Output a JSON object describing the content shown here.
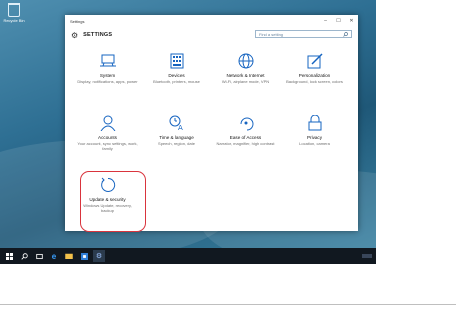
{
  "desktop": {
    "recycle_label": "Recycle Bin"
  },
  "window": {
    "title": "Settings",
    "minimize": "–",
    "maximize": "☐",
    "close": "✕"
  },
  "header": {
    "title": "SETTINGS"
  },
  "search": {
    "placeholder": "Find a setting",
    "icon": "search-icon"
  },
  "tiles": [
    {
      "name": "System",
      "desc": "Display, notifications, apps, power",
      "icon": "monitor-icon"
    },
    {
      "name": "Devices",
      "desc": "Bluetooth, printers, mouse",
      "icon": "keyboard-icon"
    },
    {
      "name": "Network & Internet",
      "desc": "Wi-Fi, airplane mode, VPN",
      "icon": "globe-icon"
    },
    {
      "name": "Personalization",
      "desc": "Background, lock screen, colors",
      "icon": "pen-icon"
    },
    {
      "name": "Accounts",
      "desc": "Your account, sync settings, work, family",
      "icon": "person-icon"
    },
    {
      "name": "Time & language",
      "desc": "Speech, region, date",
      "icon": "clock-icon"
    },
    {
      "name": "Ease of Access",
      "desc": "Narrator, magnifier, high contrast",
      "icon": "accessibility-icon"
    },
    {
      "name": "Privacy",
      "desc": "Location, camera",
      "icon": "lock-icon"
    },
    {
      "name": "Update & security",
      "desc": "Windows Update, recovery, backup",
      "icon": "refresh-icon"
    }
  ],
  "colors": {
    "accent": "#1664c0",
    "highlight": "#d9343d",
    "taskbar": "#111820"
  }
}
